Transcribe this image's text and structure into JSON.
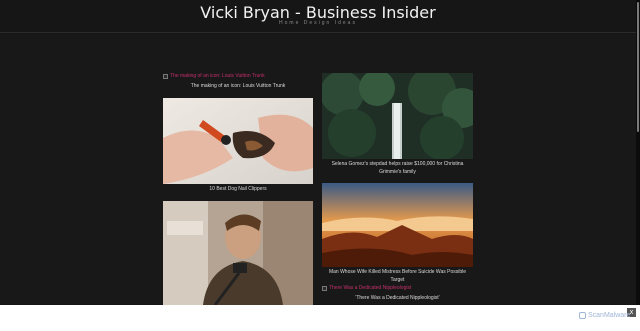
{
  "site": {
    "title": "Vicki Bryan - Business Insider",
    "tagline": "Home Design Ideas"
  },
  "articles": {
    "louis_link": "The making of an icon: Louis Vuitton Trunk",
    "louis_caption": "The making of an icon: Louis Vuitton Trunk",
    "dog_caption": "10 Best Dog Nail Clippers",
    "selena_caption": "Selena Gomez's stepdad helps raise $100,000 for Christina Grimmie's family",
    "mistress_caption": "Man Whose Wife Killed Mistress Before Suicide Was Possible Target",
    "nipple_link": "There Was a Dedicated Nippleologist",
    "nipple_caption": "'There Was a Dedicated Nippleologist'"
  },
  "footer": {
    "brand": "ScanMalware",
    "close": "x"
  }
}
